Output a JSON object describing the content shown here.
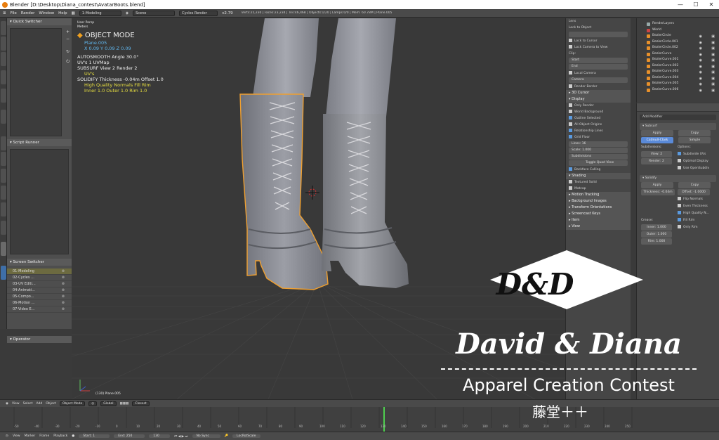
{
  "window": {
    "title": "Blender [D:\\Desktop\\Diana_contest\\AvatarBoots.blend]",
    "minimize": "—",
    "maximize": "☐",
    "close": "✕"
  },
  "menubar": {
    "items": [
      "File",
      "Render",
      "Window",
      "Help"
    ],
    "layout": "1-Modeling",
    "scene": "Scene",
    "engine": "Cycles Render",
    "version": "v2.79",
    "info": "Verts:25,230 | Faces:23,234 | Tris:46,468 | Objects:1/20 | Lamps:0/0 | Mem: 60.78M | Plane.005"
  },
  "left_tabs": [
    "Tools",
    "Create",
    "Relations",
    "Animation",
    "Physics",
    "Grease Pencil",
    "Auto",
    "Sculpt",
    "Modeling",
    "Mirror",
    "Baking",
    "Retopo",
    "Light Tool",
    "Screen"
  ],
  "quick_switcher": {
    "title": "Quick Switcher"
  },
  "script_runner": {
    "title": "Script Runner"
  },
  "screen_switcher": {
    "title": "Screen Switcher",
    "items": [
      "01-Modeling",
      "02-Cycles ...",
      "03-UV Editi...",
      "04-Animati...",
      "05-Compo...",
      "06-Motion ...",
      "07-Video E..."
    ]
  },
  "operator": {
    "title": "Operator"
  },
  "viewport_overlay": {
    "persp": "User Persp",
    "meters": "Meters",
    "mode": "OBJECT MODE",
    "object": "Plane.005",
    "loc": "X 0.09  Y 0.09  Z 0.09",
    "autosmooth": "AUTOSMOOTH  Angle 30.0°",
    "uvs": "UV's 1  UVMap",
    "subsurf": "SUBSURF  View 2  Render 2",
    "uv2": "UV's",
    "solidify": "SOLIDIFY  Thickness -0.04m  Offset 1.0",
    "hq": "High Quality Normals  Fill Rim",
    "inner": "Inner 1.0  Outer 1.0  Rim 1.0",
    "frame": "(130) Plane.005"
  },
  "properties": {
    "items": [
      "Lens",
      "Lock to Object",
      "Lock to Cursor",
      "Lock Camera to View",
      "Clip:",
      "Start",
      "End",
      "Local Camera",
      "Camera",
      "Render Border",
      "3D Cursor",
      "Display",
      "Only Render",
      "World Background",
      "Outline Selected",
      "All Object Origins",
      "Relationship Lines",
      "Grid Floor",
      "Lines",
      "Scale",
      "Subdivisions",
      "Toggle Quad View",
      "Backface Culling",
      "Shading",
      "Textured Solid",
      "Matcap",
      "Motion Tracking",
      "Background Images",
      "Transform Orientations",
      "Screencast Keys",
      "Item",
      "View"
    ],
    "lines_val": "16",
    "scale_val": "1.000"
  },
  "outliner": {
    "items": [
      "RenderLayers",
      "World",
      "BezierCircle",
      "BezierCircle.001",
      "BezierCircle.002",
      "BezierCurve",
      "BezierCurve.001",
      "BezierCurve.002",
      "BezierCurve.003",
      "BezierCurve.004",
      "BezierCurve.005",
      "BezierCurve.006"
    ]
  },
  "modifiers": {
    "search": "Add Modifier",
    "subsurf": "Subsurf",
    "apply": "Apply",
    "copy": "Copy",
    "catmull": "Catmull-Clark",
    "simple": "Simple",
    "subdivisions": "Subdivisions:",
    "options": "Options:",
    "view": "View:",
    "render": "Render:",
    "subdiv_uv": "Subdivide UVs",
    "optimal": "Optimal Display",
    "opensubdiv": "Use OpenSubdiv",
    "solidify": "Solidify",
    "thickness": "Thickness: -0.04m",
    "offset": "Offset: -1.0000",
    "flip": "Flip Normals",
    "even": "Even Thickness",
    "hq": "High Quality N...",
    "fillrim": "Fill Rim",
    "only_rim": "Only Rim",
    "crease": "Crease:",
    "inner": "Inner:",
    "outer": "Outer:",
    "rim": "Rim:",
    "inner_val": "1.000",
    "outer_val": "1.000",
    "rim_val": "1.000"
  },
  "vp_header": [
    "View",
    "Select",
    "Add",
    "Object",
    "Object Mode",
    "Global",
    "Closest"
  ],
  "timeline": {
    "cursor_frame": 130,
    "numbers": [
      -50,
      -40,
      -30,
      -20,
      -10,
      0,
      10,
      20,
      30,
      40,
      50,
      60,
      70,
      80,
      90,
      100,
      110,
      120,
      130,
      140,
      150,
      160,
      170,
      180,
      190,
      200,
      210,
      220,
      230,
      240,
      250
    ],
    "menus": [
      "View",
      "Marker",
      "Frame",
      "Playback"
    ],
    "start": "Start: 1",
    "end": "End: 250",
    "current": "130",
    "sync": "No Sync",
    "keying": "LocRotScale"
  },
  "watermark": {
    "logo": "D&D",
    "name": "David & Diana",
    "contest": "Apparel Creation Contest",
    "author": "藤堂＋＋"
  },
  "colors": {
    "accent": "#e87d0d",
    "selection_outline": "#f0a030",
    "timeline_cursor": "#4fcf4f"
  }
}
